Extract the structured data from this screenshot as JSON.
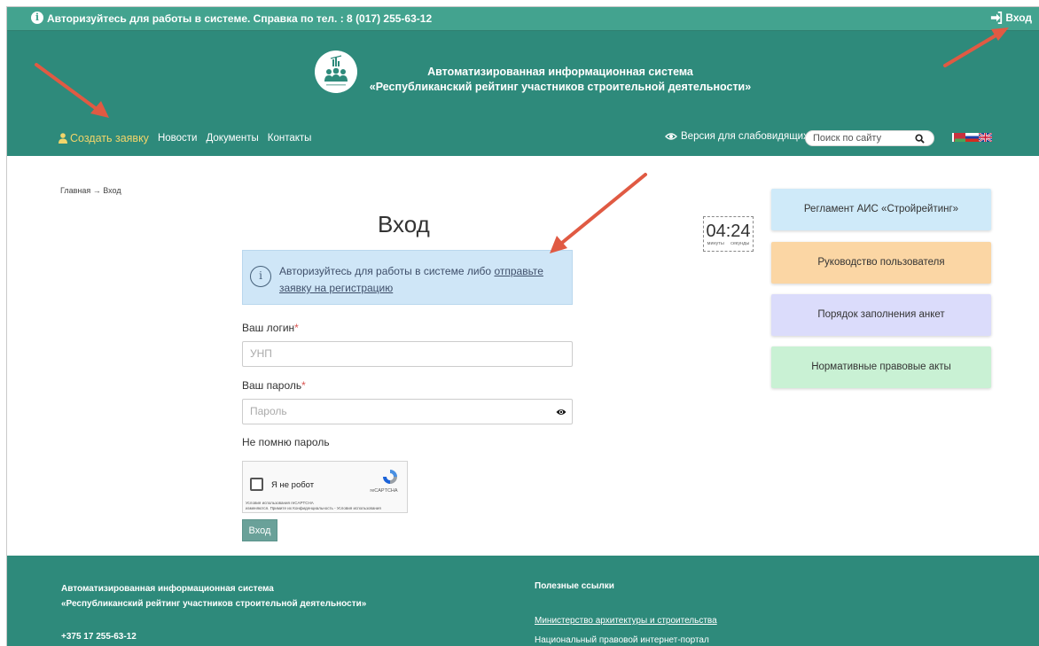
{
  "topbar": {
    "notice": "Авторизуйтесь для работы в системе. Справка по тел. : 8 (017) 255-63-12",
    "login": "Вход"
  },
  "header": {
    "title_line1": "Автоматизированная информационная система",
    "title_line2": "«Республиканский рейтинг участников строительной деятельности»",
    "nav": {
      "create": "Создать заявку",
      "news": "Новости",
      "documents": "Документы",
      "contacts": "Контакты"
    },
    "accessibility": "Версия для слабовидящих",
    "search_placeholder": "Поиск по сайту"
  },
  "main": {
    "breadcrumb": "Главная → Вход",
    "title": "Вход",
    "timer": {
      "value": "04:24",
      "minutes_label": "минуты",
      "seconds_label": "секунды"
    },
    "alert": {
      "text": "Авторизуйтесь для работы в системе либо",
      "link": "отправьте заявку на регистрацию"
    },
    "login_label": "Ваш логин",
    "login_placeholder": "УНП",
    "password_label": "Ваш пароль",
    "password_placeholder": "Пароль",
    "required_mark": "*",
    "forgot": "Не помню пароль",
    "captcha": {
      "label": "Я не робот",
      "brand": "reCAPTCHA",
      "terms_line1": "Условия использования reCAPTCHA",
      "terms_line2": "изменяются. Примите их",
      "terms_line3": "Конфиденциальность - Условия использования"
    },
    "submit": "Вход"
  },
  "sidebar": {
    "buttons": [
      {
        "label": "Регламент АИС «Стройрейтинг»",
        "color": "#cfeaf9"
      },
      {
        "label": "Руководство пользователя",
        "color": "#fbd6a4"
      },
      {
        "label": "Порядок заполнения анкет",
        "color": "#dbdcfb"
      },
      {
        "label": "Нормативные правовые акты",
        "color": "#c9f1d4"
      }
    ]
  },
  "footer": {
    "title_line1": "Автоматизированная информационная система",
    "title_line2": "«Республиканский рейтинг участников строительной деятельности»",
    "phone": "+375 17 255-63-12",
    "links_title": "Полезные ссылки",
    "link1": "Министерство архитектуры и строительства",
    "link2": "Национальный правовой интернет-портал"
  },
  "colors": {
    "primary": "#2e8a7b",
    "topbar": "#43a38f",
    "accent": "#f2d56a",
    "arrow": "#e05a43"
  }
}
